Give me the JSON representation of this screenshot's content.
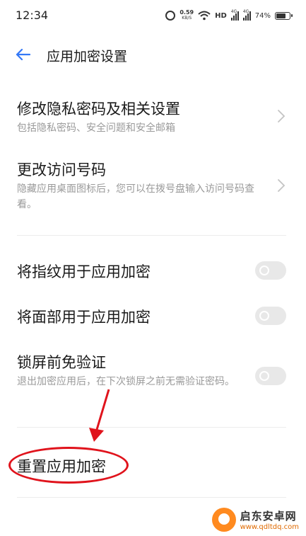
{
  "status_bar": {
    "time": "12:34",
    "speed_value": "0.59",
    "speed_unit": "KB/S",
    "hd_label": "HD",
    "signal1_label": "4G",
    "signal2_label": "4G",
    "battery_percent": "74%",
    "battery_level": 0.74
  },
  "header": {
    "title": "应用加密设置"
  },
  "items": {
    "privacy": {
      "title": "修改隐私密码及相关设置",
      "subtitle": "包括隐私密码、安全问题和安全邮箱"
    },
    "access_code": {
      "title": "更改访问号码",
      "subtitle": "隐藏应用桌面图标后，您可以在拨号盘输入访问号码查看。"
    },
    "fingerprint": {
      "title": "将指纹用于应用加密",
      "enabled": false
    },
    "face": {
      "title": "将面部用于应用加密",
      "enabled": false
    },
    "lockscreen": {
      "title": "锁屏前免验证",
      "subtitle": "退出加密应用后，在下次锁屏之前无需验证密码。",
      "enabled": false
    },
    "reset": {
      "title": "重置应用加密"
    }
  },
  "watermark": {
    "name": "启东安卓网",
    "url": "www.qdltdq.com"
  },
  "colors": {
    "accent": "#3478f6",
    "annotation": "#e0131c",
    "toggle_off": "#e8e8e8"
  }
}
